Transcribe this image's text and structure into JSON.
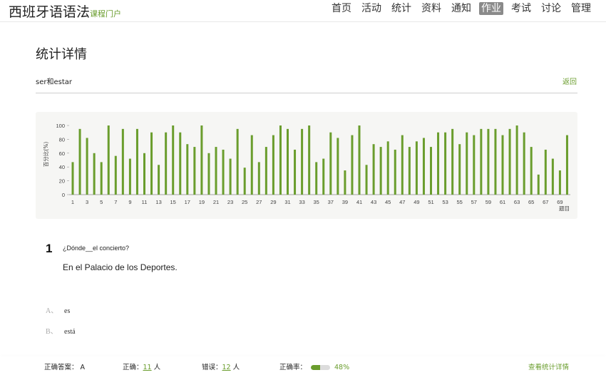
{
  "brand": {
    "title": "西班牙语语法",
    "subtitle": "课程门户"
  },
  "nav": [
    {
      "label": "首页"
    },
    {
      "label": "活动"
    },
    {
      "label": "统计"
    },
    {
      "label": "资料"
    },
    {
      "label": "通知"
    },
    {
      "label": "作业",
      "active": true
    },
    {
      "label": "考试"
    },
    {
      "label": "讨论"
    },
    {
      "label": "管理"
    }
  ],
  "page": {
    "title": "统计详情",
    "subject": "ser和estar",
    "back": "返回"
  },
  "chart_data": {
    "type": "bar",
    "ylabel": "百分比(%)",
    "xlabel": "题目",
    "ylim": [
      0,
      100
    ],
    "yticks": [
      0,
      20,
      40,
      60,
      80,
      100
    ],
    "x_tick_labels": [
      "1",
      "3",
      "5",
      "7",
      "9",
      "11",
      "13",
      "15",
      "17",
      "19",
      "21",
      "23",
      "25",
      "27",
      "29",
      "31",
      "33",
      "35",
      "37",
      "39",
      "41",
      "43",
      "45",
      "47",
      "49",
      "51",
      "53",
      "55",
      "57",
      "59",
      "61",
      "63",
      "65",
      "67",
      "69"
    ],
    "categories": [
      1,
      2,
      3,
      4,
      5,
      6,
      7,
      8,
      9,
      10,
      11,
      12,
      13,
      14,
      15,
      16,
      17,
      18,
      19,
      20,
      21,
      22,
      23,
      24,
      25,
      26,
      27,
      28,
      29,
      30,
      31,
      32,
      33,
      34,
      35,
      36,
      37,
      38,
      39,
      40,
      41,
      42,
      43,
      44,
      45,
      46,
      47,
      48,
      49,
      50,
      51,
      52,
      53,
      54,
      55,
      56,
      57,
      57,
      59,
      60,
      61,
      62,
      63,
      64,
      65,
      66,
      67,
      68,
      69,
      70
    ],
    "values": [
      47,
      95,
      82,
      60,
      47,
      100,
      56,
      95,
      52,
      95,
      60,
      90,
      43,
      90,
      100,
      90,
      73,
      69,
      100,
      60,
      69,
      65,
      52,
      95,
      39,
      86,
      47,
      69,
      86,
      100,
      95,
      65,
      95,
      100,
      47,
      52,
      90,
      82,
      35,
      86,
      100,
      43,
      73,
      69,
      77,
      65,
      86,
      69,
      77,
      82,
      69,
      90,
      90,
      95,
      73,
      90,
      86,
      95,
      95,
      95,
      86,
      95,
      100,
      90,
      69,
      29,
      65,
      52,
      35,
      86
    ],
    "bar_color": "#6a9d2d",
    "grid": false
  },
  "question": {
    "number": "1",
    "text": "¿Dónde__el concierto?",
    "answer_text": "En el Palacio de los Deportes.",
    "options": [
      {
        "letter": "A、",
        "text": "es"
      },
      {
        "letter": "B、",
        "text": "está"
      }
    ]
  },
  "footer": {
    "correct_answer_label": "正确答案：",
    "correct_answer": "A",
    "correct_label": "正确：",
    "correct_count": "11",
    "wrong_label": "错误：",
    "wrong_count": "12",
    "person_unit": "人",
    "rate_label": "正确率：",
    "rate": "48%",
    "rate_value": 48,
    "details_link": "查看统计详情"
  }
}
